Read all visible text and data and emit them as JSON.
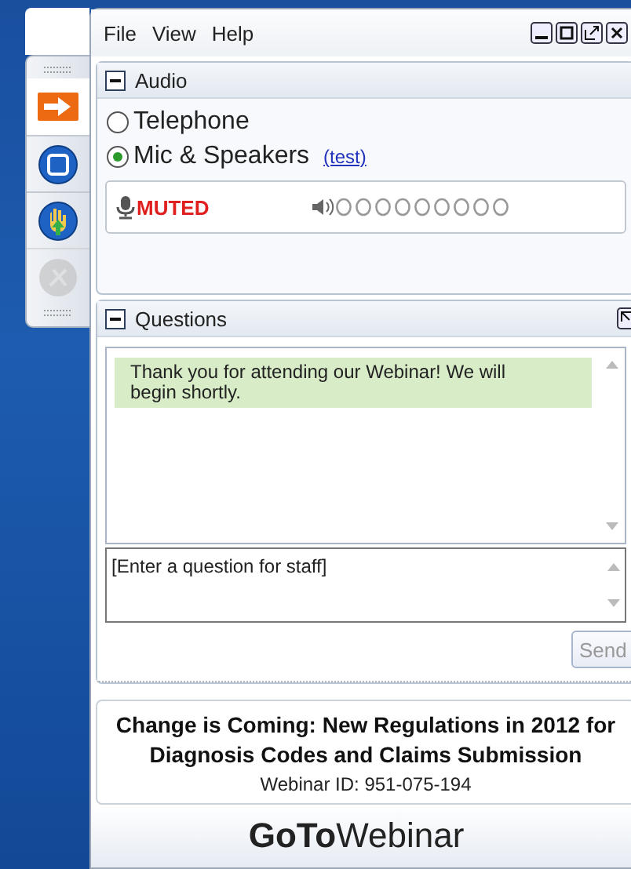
{
  "menu": [
    "File",
    "View",
    "Help"
  ],
  "toolbar": [
    {
      "kind": "arrow",
      "disabled": false
    },
    {
      "kind": "screen",
      "disabled": false
    },
    {
      "kind": "hand",
      "disabled": false
    },
    {
      "kind": "mute",
      "disabled": true
    }
  ],
  "audio": {
    "title": "Audio",
    "expanded": true,
    "options": [
      {
        "label": "Telephone",
        "selected": false
      },
      {
        "label": "Mic & Speakers",
        "selected": true
      }
    ],
    "test_link": "(test)",
    "mic_status": "MUTED"
  },
  "questions": {
    "title": "Questions",
    "expanded": true,
    "messages": [
      "Thank you for attending our Webinar! We will begin shortly."
    ],
    "input": {
      "placeholder": "[Enter a question for staff]"
    },
    "send": {
      "label": "Send",
      "disabled": true
    }
  },
  "webinar": {
    "title": "Change is Coming: New Regulations in 2012 for Diagnosis Codes and Claims Submission",
    "id": "Webinar ID: 951-075-194"
  },
  "logo": "**GoTo**Webinar"
}
